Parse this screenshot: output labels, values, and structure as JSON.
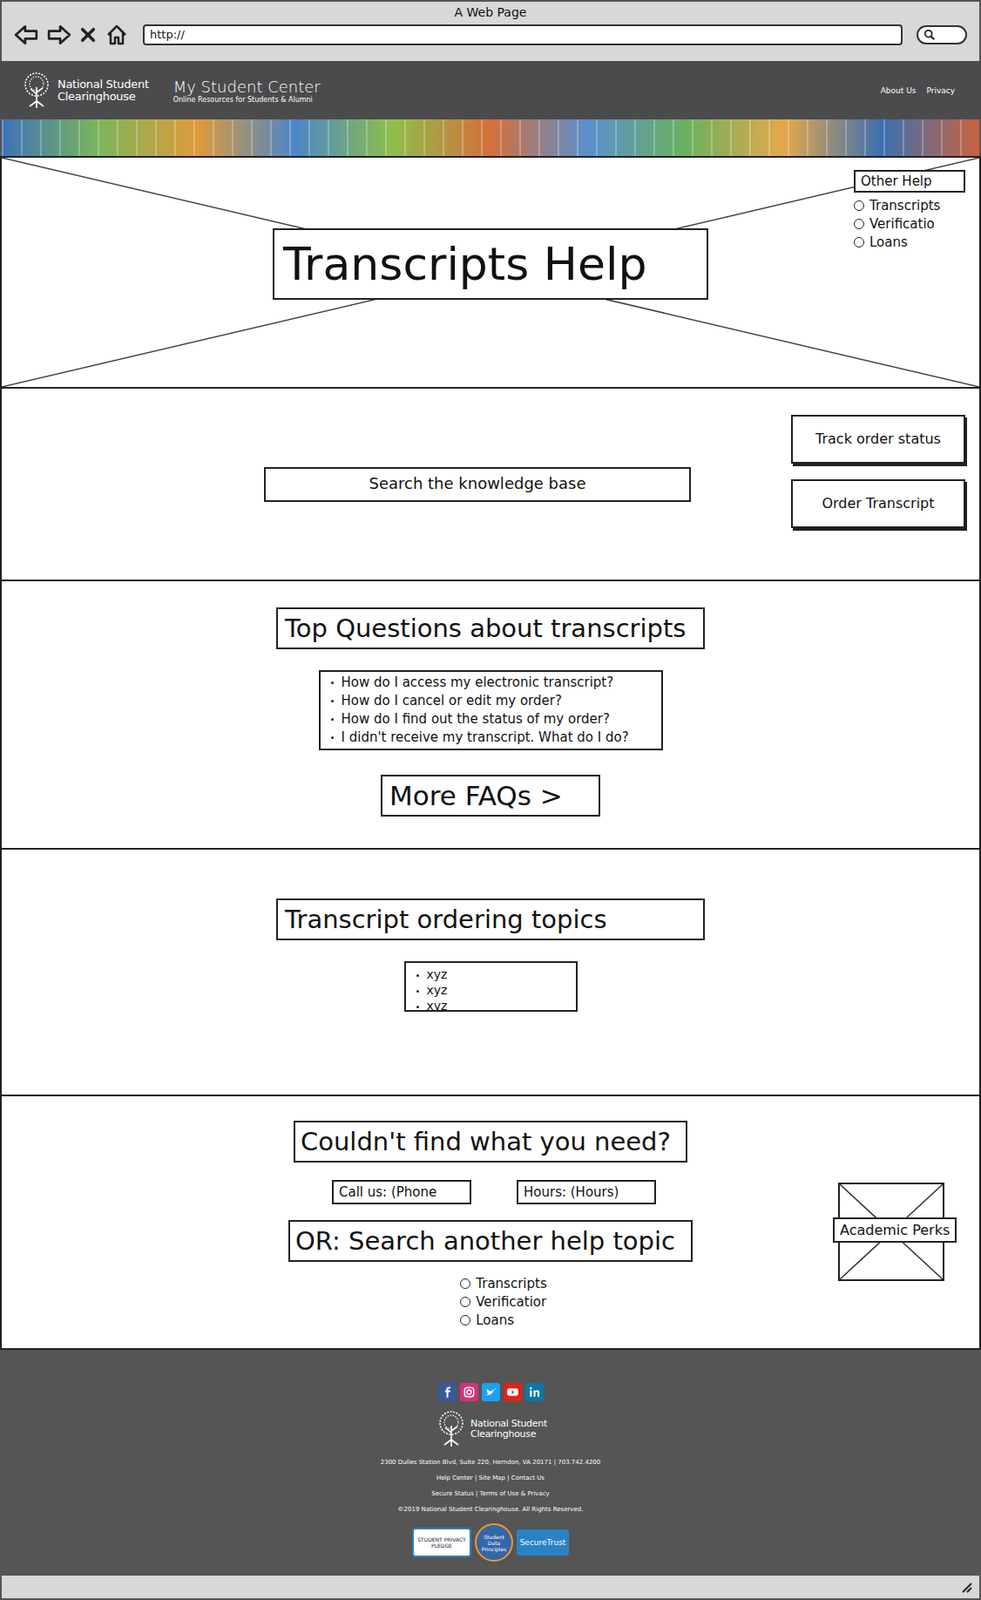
{
  "browser": {
    "title": "A Web Page",
    "url": "http://"
  },
  "header": {
    "org_line1": "National Student",
    "org_line2": "Clearinghouse",
    "app_title": "My Student Center",
    "app_subtitle": "Online Resources for Students & Alumni",
    "links": [
      "About Us",
      "Privacy"
    ]
  },
  "hero": {
    "title": "Transcripts Help",
    "other_help": {
      "label": "Other Help",
      "options": [
        {
          "label": "Transcripts",
          "selected": false
        },
        {
          "label": "Verificatio",
          "selected": false
        },
        {
          "label": "Loans",
          "selected": false
        }
      ]
    }
  },
  "search": {
    "placeholder": "Search the knowledge base",
    "buttons": [
      "Track order status",
      "Order Transcript"
    ]
  },
  "top_questions": {
    "heading": "Top Questions about transcripts",
    "items": [
      "How do I access my electronic transcript?",
      "How do I cancel or edit my order?",
      "How do I find out the status of my order?",
      "I didn't receive my transcript. What do I do?"
    ],
    "more": "More FAQs >"
  },
  "ordering_topics": {
    "heading": "Transcript ordering topics",
    "items": [
      "xyz",
      "xyz",
      "xyz"
    ]
  },
  "contact": {
    "heading": "Couldn't find what you need?",
    "phone": "Call us: (Phone",
    "hours": "Hours: (Hours)",
    "search_heading": "OR: Search another help topic",
    "options": [
      {
        "label": "Transcripts",
        "selected": false
      },
      {
        "label": "Verificatior",
        "selected": false
      },
      {
        "label": "Loans",
        "selected": false
      }
    ],
    "promo": "Academic Perks"
  },
  "footer": {
    "social": [
      {
        "kind": "facebook",
        "color": "#3b5998"
      },
      {
        "kind": "instagram",
        "color": "#d6317a"
      },
      {
        "kind": "twitter",
        "color": "#1da1f2"
      },
      {
        "kind": "youtube",
        "color": "#e62117"
      },
      {
        "kind": "linkedin",
        "color": "#0e76a8"
      }
    ],
    "org_line1": "National Student",
    "org_line2": "Clearinghouse",
    "address": "2300 Dulles Station Blvd, Suite 220, Herndon, VA 20171 | 703.742.4200",
    "links": "Help Center | Site Map | Contact Us",
    "legal": "Secure Status | Terms of Use & Privacy",
    "copyright": "©2019 National Student Clearinghouse. All Rights Reserved.",
    "badges": [
      "STUDENT PRIVACY PLEDGE",
      "Student Data Principles",
      "SecureTrust"
    ]
  }
}
